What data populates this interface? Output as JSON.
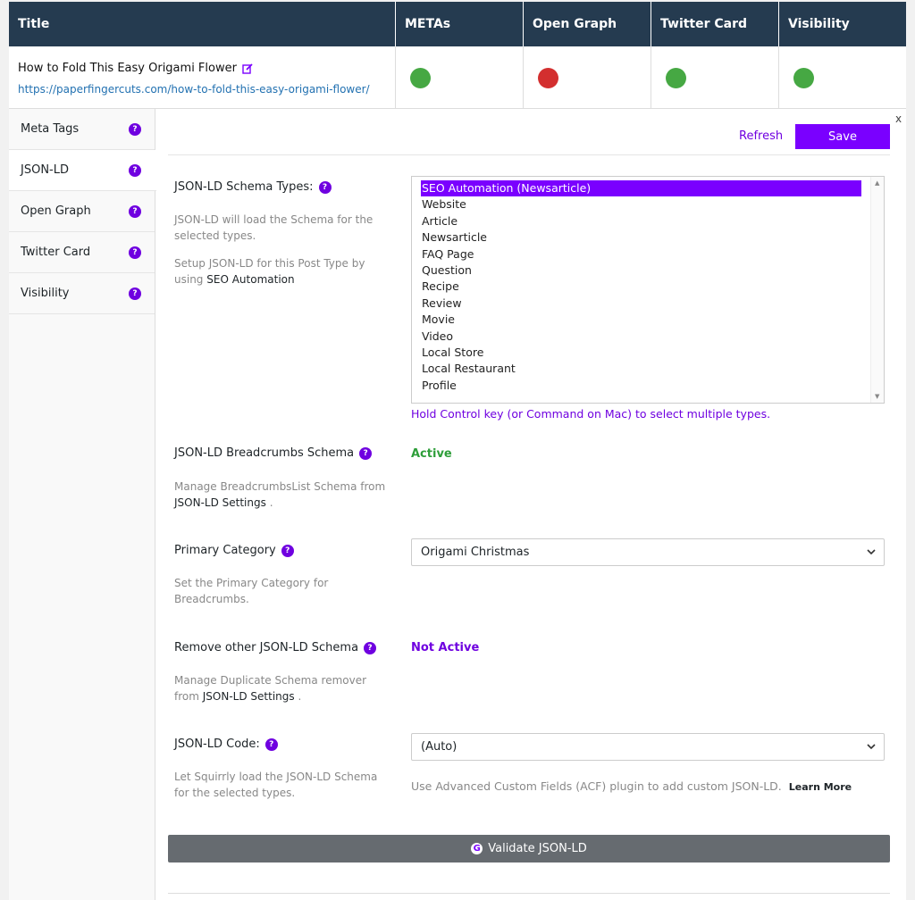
{
  "table": {
    "headers": [
      "Title",
      "METAs",
      "Open Graph",
      "Twitter Card",
      "Visibility"
    ],
    "post": {
      "title": "How to Fold This Easy Origami Flower",
      "url": "https://paperfingercuts.com/how-to-fold-this-easy-origami-flower/"
    },
    "statuses": [
      {
        "name": "METAs",
        "color": "#46a843"
      },
      {
        "name": "Open Graph",
        "color": "#d32f2f"
      },
      {
        "name": "Twitter Card",
        "color": "#46a843"
      },
      {
        "name": "Visibility",
        "color": "#46a843"
      }
    ]
  },
  "sidebar": {
    "items": [
      {
        "label": "Meta Tags"
      },
      {
        "label": "JSON-LD"
      },
      {
        "label": "Open Graph"
      },
      {
        "label": "Twitter Card"
      },
      {
        "label": "Visibility"
      }
    ],
    "active": "JSON-LD"
  },
  "actions": {
    "close": "x",
    "refresh": "Refresh",
    "save": "Save"
  },
  "schema_types": {
    "label": "JSON-LD Schema Types:",
    "desc1": "JSON-LD will load the Schema for the selected types.",
    "desc2_prefix": "Setup JSON-LD for this Post Type by using",
    "desc2_link": "SEO Automation",
    "options": [
      "SEO Automation (Newsarticle)",
      "Website",
      "Article",
      "Newsarticle",
      "FAQ Page",
      "Question",
      "Recipe",
      "Review",
      "Movie",
      "Video",
      "Local Store",
      "Local Restaurant",
      "Profile"
    ],
    "selected": "SEO Automation (Newsarticle)",
    "hint": "Hold Control key (or Command on Mac) to select multiple types."
  },
  "breadcrumbs": {
    "label": "JSON-LD Breadcrumbs Schema",
    "status": "Active",
    "desc_prefix": "Manage BreadcrumbsList Schema from",
    "desc_link": "JSON-LD Settings",
    "desc_suffix": "."
  },
  "primary_category": {
    "label": "Primary Category",
    "value": "Origami Christmas",
    "desc": "Set the Primary Category for Breadcrumbs."
  },
  "remove_schema": {
    "label": "Remove other JSON-LD Schema",
    "status": "Not Active",
    "desc_prefix": "Manage Duplicate Schema remover from",
    "desc_link": "JSON-LD Settings",
    "desc_suffix": "."
  },
  "code": {
    "label": "JSON-LD Code:",
    "value": "(Auto)",
    "desc": "Let Squirrly load the JSON-LD Schema for the selected types.",
    "note": "Use Advanced Custom Fields (ACF) plugin to add custom JSON-LD.",
    "learn_more": "Learn More"
  },
  "validate": {
    "icon": "G",
    "label": "Validate JSON-LD"
  },
  "colors": {
    "header_bg": "#253b50",
    "accent": "#7a00ff",
    "active_green": "#2e9e3a",
    "not_active_purple": "#6f00e0"
  },
  "q_mark": "?"
}
